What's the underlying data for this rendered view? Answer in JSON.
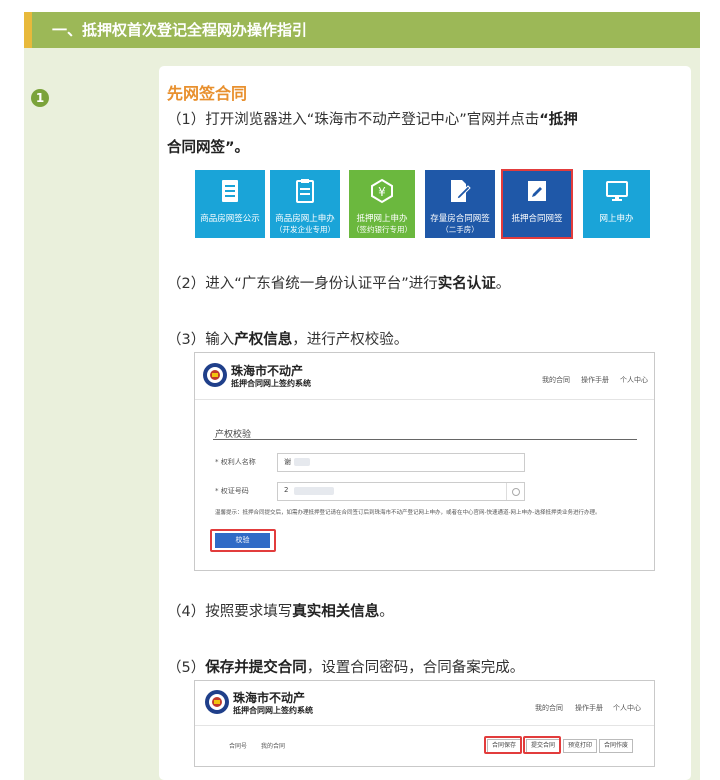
{
  "banner": {
    "title": "一、抵押权首次登记全程网办操作指引"
  },
  "step": {
    "number": "1"
  },
  "section": {
    "heading": "先网签合同"
  },
  "steps": {
    "s1": {
      "text1": "（1）打开浏览器进入“珠海市不动产登记中心”官网并点击",
      "bold": "“抵押",
      "bold2": "合同网签”",
      "end": "。"
    },
    "s2": {
      "text1": "（2）进入“广东省统一身份认证平台”进行",
      "bold": "实名认证",
      "end": "。"
    },
    "s3": {
      "text1": "（3）输入",
      "bold": "产权信息",
      "end": "，进行产权校验。"
    },
    "s4": {
      "text1": "（4）按照要求填写",
      "bold": "真实相关信息",
      "end": "。"
    },
    "s5": {
      "text1": "（5）",
      "bold": "保存并提交合同",
      "end": "，设置合同密码，合同备案完成。"
    }
  },
  "tiles": [
    {
      "label": "商品房网签公示",
      "sub": "",
      "color": "#1aa4d8",
      "icon": "document-icon"
    },
    {
      "label": "商品房网上申办",
      "sub": "（开发企业专用）",
      "color": "#1aa4d8",
      "icon": "clipboard-icon"
    },
    {
      "label": "抵押网上申办",
      "sub": "（签约银行专用）",
      "color": "#6bb83e",
      "icon": "yen-icon"
    },
    {
      "label": "存量房合同网签",
      "sub": "（二手房）",
      "color": "#1f58a8",
      "icon": "edit-doc-icon"
    },
    {
      "label": "抵押合同网签",
      "sub": "",
      "color": "#1f58a8",
      "icon": "edit-doc-icon",
      "selected": true
    },
    {
      "label": "网上申办",
      "sub": "",
      "color": "#1aa4d8",
      "icon": "monitor-icon"
    }
  ],
  "shot1": {
    "sys_title": "珠海市不动产",
    "sys_subtitle": "抵押合同网上签约系统",
    "nav": [
      "我的合同",
      "操作手册",
      "个人中心"
    ],
    "form_title": "产权校验",
    "fields": [
      {
        "label": "* 权利人名称",
        "value": "谢"
      },
      {
        "label": "* 权证号码",
        "value": "2"
      }
    ],
    "tip": "温馨提示：抵押合同提交后，如需办理抵押登记请在合同签订后到珠海市不动产登记网上申办，或者在中心官网-快速通道-网上申办-选择抵押类业务进行办理。",
    "verify_button": "校验"
  },
  "shot2": {
    "sys_title": "珠海市不动产",
    "sys_subtitle": "抵押合同网上签约系统",
    "nav": [
      "我的合同",
      "操作手册",
      "个人中心"
    ],
    "left_labels": [
      "合同号",
      "我的合同"
    ],
    "buttons": [
      "合同保存",
      "提交合同",
      "预览打印",
      "合同作废"
    ]
  },
  "colors": {
    "banner": "#9cb857",
    "accent": "#e8b93b",
    "heading": "#e8902e",
    "highlight": "#e23c3c",
    "primary_button": "#2f6bc6"
  }
}
